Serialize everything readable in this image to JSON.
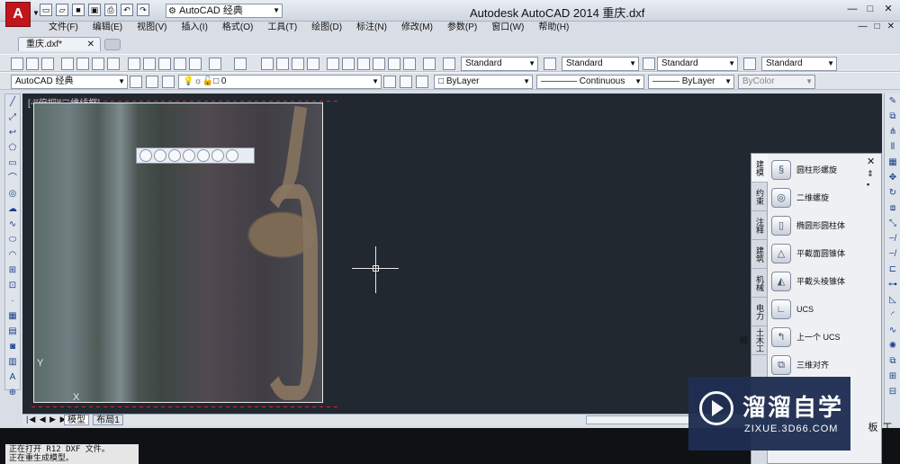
{
  "app": {
    "title": "Autodesk AutoCAD 2014    重庆.dxf",
    "logo_letter": "A",
    "workspace": "AutoCAD 经典",
    "window_buttons": [
      "—",
      "□",
      "✕"
    ]
  },
  "menu": {
    "items": [
      "文件(F)",
      "编辑(E)",
      "视图(V)",
      "插入(I)",
      "格式(O)",
      "工具(T)",
      "绘图(D)",
      "标注(N)",
      "修改(M)",
      "参数(P)",
      "窗口(W)",
      "帮助(H)"
    ],
    "right_controls": [
      "—",
      "□",
      "✕"
    ]
  },
  "document_tab": {
    "label": "重庆.dxf*",
    "close": "✕"
  },
  "toolbar1": {
    "text_style": "Standard",
    "dim_style": "Standard",
    "table_style": "Standard",
    "multileader_style": "Standard"
  },
  "toolbar2": {
    "workspace": "AutoCAD 经典",
    "layer": "0",
    "color": "ByLayer",
    "linetype": "Continuous",
    "lineweight": "ByLayer",
    "plotstyle": "ByColor"
  },
  "canvas": {
    "viewport_label": "[-][俯视][二维线框]",
    "ucs_y": "Y",
    "ucs_x": "X"
  },
  "layout_tabs": {
    "nav": "|◀ ◀ ▶ ▶|",
    "model": "模型",
    "layout1": "布局1"
  },
  "command": {
    "history": [
      "正在打开 R12 DXF 文件。",
      "正在重生成模型。"
    ]
  },
  "palette": {
    "title": "工具选项板",
    "close": "✕",
    "tabs": [
      "建模",
      "约束",
      "注释",
      "建筑",
      "机械",
      "电力",
      "土木工程"
    ],
    "items": [
      {
        "label": "圆柱形螺旋",
        "icon": "helix-icon"
      },
      {
        "label": "二维螺旋",
        "icon": "spiral-icon"
      },
      {
        "label": "椭圆形圆柱体",
        "icon": "elliptical-cylinder-icon"
      },
      {
        "label": "平截面圆锥体",
        "icon": "frustum-cone-icon"
      },
      {
        "label": "平截头棱锥体",
        "icon": "frustum-pyramid-icon"
      },
      {
        "label": "UCS",
        "icon": "ucs-icon"
      },
      {
        "label": "上一个 UCS",
        "icon": "ucs-previous-icon"
      },
      {
        "label": "三维对齐",
        "icon": "3d-align-icon"
      }
    ]
  },
  "watermark": {
    "title": "溜溜自学",
    "subtitle": "ZIXUE.3D66.COM"
  },
  "colors": {
    "canvas": "#212830",
    "accent_red": "#c0161b",
    "watermark_bg": "#1f2f52"
  }
}
